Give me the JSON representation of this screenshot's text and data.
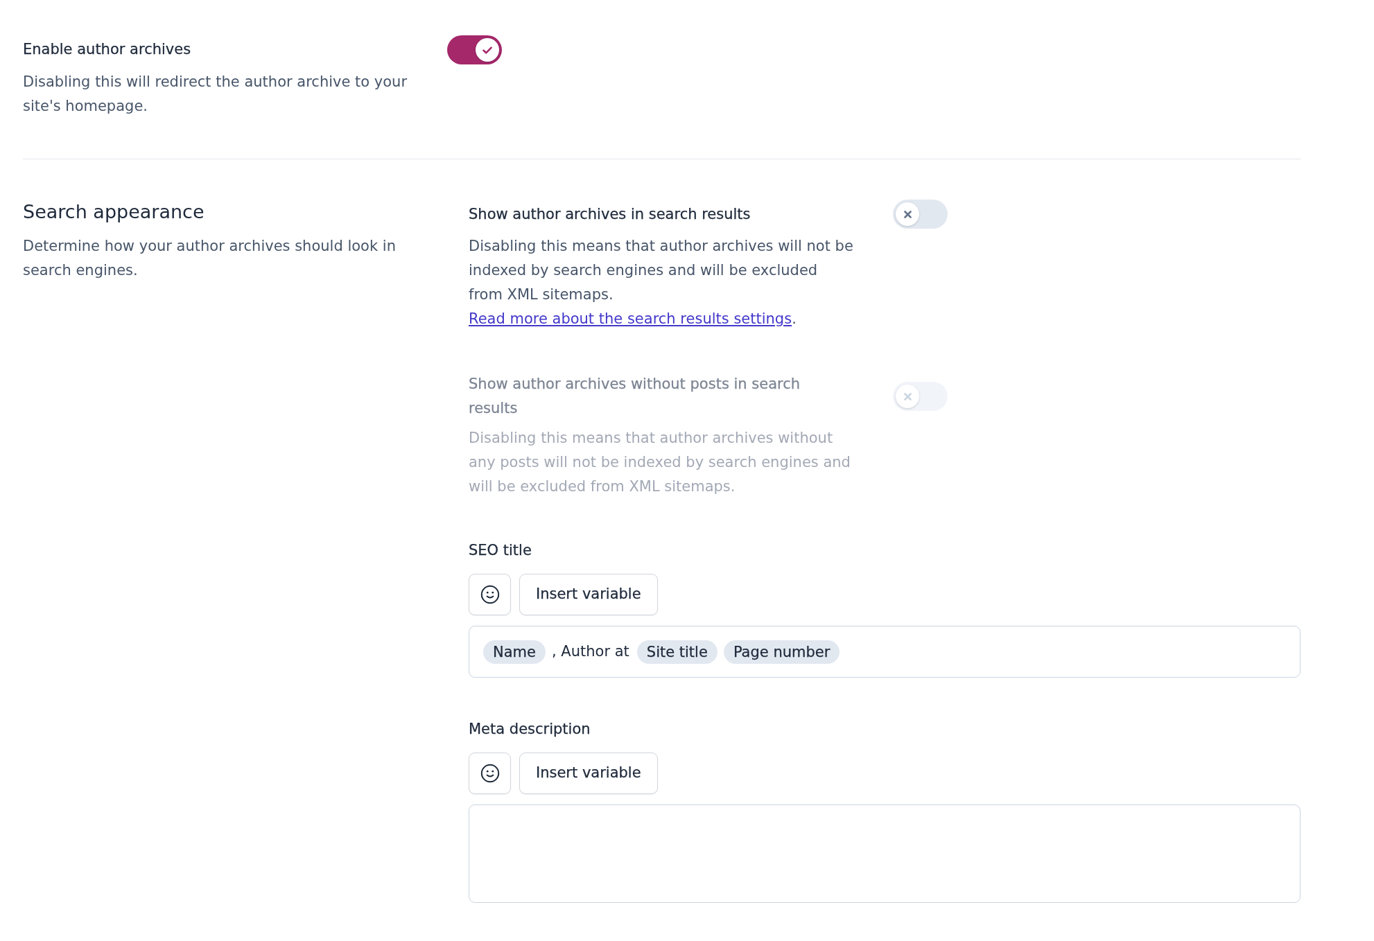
{
  "archive_toggle": {
    "label": "Enable author archives",
    "description": "Disabling this will redirect the author archive to your site's homepage.",
    "on": true
  },
  "search_appearance": {
    "title": "Search appearance",
    "description": "Determine how your author archives should look in search engines.",
    "toggles": [
      {
        "label": "Show author archives in search results",
        "description": "Disabling this means that author archives will not be indexed by search engines and will be excluded from XML sitemaps.",
        "link": "Read more about the search results settings",
        "after_link": ".",
        "on": false,
        "disabled": false
      },
      {
        "label": "Show author archives without posts in search results",
        "description": "Disabling this means that author archives without any posts will not be indexed by search engines and will be excluded from XML sitemaps.",
        "on": false,
        "disabled": true
      }
    ],
    "fields": [
      {
        "label": "SEO title",
        "insert_button": "Insert variable",
        "kind": "single",
        "segments": [
          {
            "kind": "variable",
            "text": "Name"
          },
          {
            "kind": "text",
            "text": ", Author at"
          },
          {
            "kind": "variable",
            "text": "Site title"
          },
          {
            "kind": "variable",
            "text": "Page number"
          }
        ]
      },
      {
        "label": "Meta description",
        "insert_button": "Insert variable",
        "kind": "multi"
      }
    ]
  }
}
